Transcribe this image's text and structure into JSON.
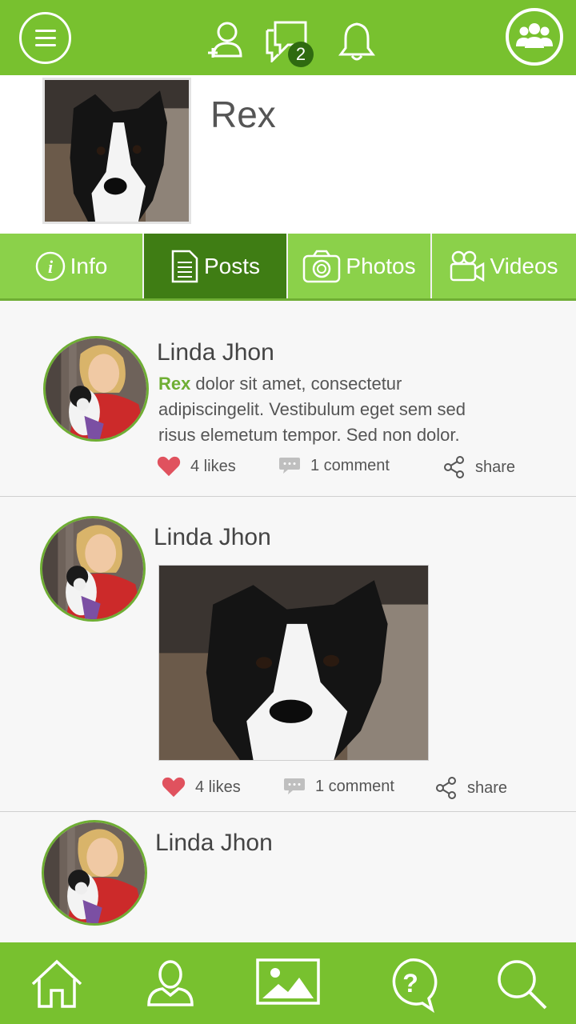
{
  "header": {
    "menu_icon": "hamburger-icon",
    "add_friend_icon": "add-user-icon",
    "messages_icon": "chat-bubbles-icon",
    "messages_badge": "2",
    "notifications_icon": "bell-icon",
    "groups_icon": "group-icon"
  },
  "profile": {
    "name": "Rex"
  },
  "tabs": [
    {
      "label": "Info",
      "icon": "info-icon"
    },
    {
      "label": "Posts",
      "icon": "document-icon"
    },
    {
      "label": "Photos",
      "icon": "camera-icon"
    },
    {
      "label": "Videos",
      "icon": "video-camera-icon"
    }
  ],
  "posts": [
    {
      "author": "Linda Jhon",
      "tag": "Rex",
      "text": "dolor sit amet, consectetur adipiscingelit. Vestibulum eget sem sed risus elemetum tempor. Sed non dolor.",
      "likes": "4 likes",
      "comments": "1 comment",
      "share": "share"
    },
    {
      "author": "Linda Jhon",
      "likes": "4 likes",
      "comments": "1 comment",
      "share": "share"
    },
    {
      "author": "Linda Jhon"
    }
  ],
  "bottom_nav": [
    {
      "icon": "home-icon"
    },
    {
      "icon": "profile-icon"
    },
    {
      "icon": "gallery-icon"
    },
    {
      "icon": "help-icon"
    },
    {
      "icon": "search-icon"
    }
  ],
  "colors": {
    "brand_green": "#78c12f",
    "tab_green": "#8bd14a",
    "active_tab": "#3f7d14",
    "like_red": "#e0525e"
  }
}
